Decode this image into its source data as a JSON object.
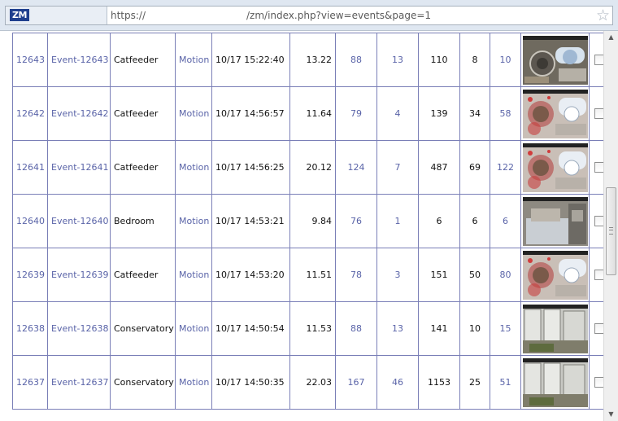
{
  "browser": {
    "logo_text": "ZM",
    "url_scheme": "https://",
    "url_path": "/zm/index.php?view=events&page=1",
    "bookmark_icon": "star-icon"
  },
  "events": [
    {
      "id": "12643",
      "name": "Event-12643",
      "monitor": "Catfeeder",
      "cause": "Motion",
      "time": "10/17 15:22:40",
      "length": "13.22",
      "frames": "88",
      "alarm_frames": "13",
      "tot_score": "110",
      "avg_score": "8",
      "max_score": "10",
      "thumb": "catfeeder"
    },
    {
      "id": "12642",
      "name": "Event-12642",
      "monitor": "Catfeeder",
      "cause": "Motion",
      "time": "10/17 14:56:57",
      "length": "11.64",
      "frames": "79",
      "alarm_frames": "4",
      "tot_score": "139",
      "avg_score": "34",
      "max_score": "58",
      "thumb": "catfeeder-red"
    },
    {
      "id": "12641",
      "name": "Event-12641",
      "monitor": "Catfeeder",
      "cause": "Motion",
      "time": "10/17 14:56:25",
      "length": "20.12",
      "frames": "124",
      "alarm_frames": "7",
      "tot_score": "487",
      "avg_score": "69",
      "max_score": "122",
      "thumb": "catfeeder-red"
    },
    {
      "id": "12640",
      "name": "Event-12640",
      "monitor": "Bedroom",
      "cause": "Motion",
      "time": "10/17 14:53:21",
      "length": "9.84",
      "frames": "76",
      "alarm_frames": "1",
      "tot_score": "6",
      "avg_score": "6",
      "max_score": "6",
      "thumb": "bedroom"
    },
    {
      "id": "12639",
      "name": "Event-12639",
      "monitor": "Catfeeder",
      "cause": "Motion",
      "time": "10/17 14:53:20",
      "length": "11.51",
      "frames": "78",
      "alarm_frames": "3",
      "tot_score": "151",
      "avg_score": "50",
      "max_score": "80",
      "thumb": "catfeeder-red"
    },
    {
      "id": "12638",
      "name": "Event-12638",
      "monitor": "Conservatory",
      "cause": "Motion",
      "time": "10/17 14:50:54",
      "length": "11.53",
      "frames": "88",
      "alarm_frames": "13",
      "tot_score": "141",
      "avg_score": "10",
      "max_score": "15",
      "thumb": "conservatory"
    },
    {
      "id": "12637",
      "name": "Event-12637",
      "monitor": "Conservatory",
      "cause": "Motion",
      "time": "10/17 14:50:35",
      "length": "22.03",
      "frames": "167",
      "alarm_frames": "46",
      "tot_score": "1153",
      "avg_score": "25",
      "max_score": "51",
      "thumb": "conservatory"
    }
  ],
  "colors": {
    "link": "#5a64a8",
    "grid": "#7a7fb7",
    "logo_bg": "#1f3f8e"
  }
}
